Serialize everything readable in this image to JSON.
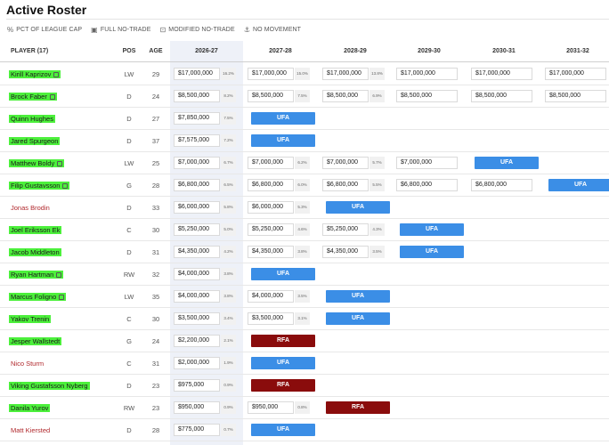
{
  "page": {
    "title": "Active Roster"
  },
  "legend": [
    {
      "icon": "%",
      "label": "PCT OF LEAGUE CAP",
      "name": "pct-legend"
    },
    {
      "icon": "▣",
      "label": "FULL NO-TRADE",
      "name": "full-no-trade-legend"
    },
    {
      "icon": "⊡",
      "label": "MODIFIED NO-TRADE",
      "name": "modified-no-trade-legend"
    },
    {
      "icon": "⚓",
      "label": "NO MOVEMENT",
      "name": "no-movement-legend"
    }
  ],
  "table": {
    "headers": {
      "player": "PLAYER (17)",
      "pos": "POS",
      "age": "AGE",
      "years": [
        "2026-27",
        "2027-28",
        "2028-29",
        "2029-30",
        "2030-31",
        "2031-32"
      ]
    },
    "rows": [
      {
        "player": "Kirill Kaprizov",
        "clause": true,
        "highlight": true,
        "pos": "LW",
        "age": "29",
        "cells": [
          {
            "v": "$17,000,000",
            "p": "16.2%"
          },
          {
            "v": "$17,000,000",
            "p": "15.0%"
          },
          {
            "v": "$17,000,000",
            "p": "13.8%"
          },
          {
            "v": "$17,000,000"
          },
          {
            "v": "$17,000,000"
          },
          {
            "v": "$17,000,000"
          }
        ]
      },
      {
        "player": "Brock Faber",
        "clause": true,
        "highlight": true,
        "pos": "D",
        "age": "24",
        "cells": [
          {
            "v": "$8,500,000",
            "p": "8.2%"
          },
          {
            "v": "$8,500,000",
            "p": "7.5%"
          },
          {
            "v": "$8,500,000",
            "p": "6.9%"
          },
          {
            "v": "$8,500,000"
          },
          {
            "v": "$8,500,000"
          },
          {
            "v": "$8,500,000"
          }
        ]
      },
      {
        "player": "Quinn Hughes",
        "clause": false,
        "highlight": true,
        "pos": "D",
        "age": "27",
        "cells": [
          {
            "v": "$7,850,000",
            "p": "7.5%"
          },
          {
            "badge": "UFA"
          }
        ]
      },
      {
        "player": "Jared Spurgeon",
        "clause": false,
        "highlight": true,
        "pos": "D",
        "age": "37",
        "cells": [
          {
            "v": "$7,575,000",
            "p": "7.2%"
          },
          {
            "badge": "UFA"
          }
        ]
      },
      {
        "player": "Matthew Boldy",
        "clause": true,
        "highlight": true,
        "pos": "LW",
        "age": "25",
        "cells": [
          {
            "v": "$7,000,000",
            "p": "6.7%"
          },
          {
            "v": "$7,000,000",
            "p": "6.2%"
          },
          {
            "v": "$7,000,000",
            "p": "5.7%"
          },
          {
            "v": "$7,000,000"
          },
          {
            "badge": "UFA"
          }
        ]
      },
      {
        "player": "Filip Gustavsson",
        "clause": true,
        "highlight": true,
        "pos": "G",
        "age": "28",
        "cells": [
          {
            "v": "$6,800,000",
            "p": "6.5%"
          },
          {
            "v": "$6,800,000",
            "p": "6.0%"
          },
          {
            "v": "$6,800,000",
            "p": "5.5%"
          },
          {
            "v": "$6,800,000"
          },
          {
            "v": "$6,800,000"
          },
          {
            "badge": "UFA"
          }
        ]
      },
      {
        "player": "Jonas Brodin",
        "clause": false,
        "highlight": false,
        "red": true,
        "pos": "D",
        "age": "33",
        "cells": [
          {
            "v": "$6,000,000",
            "p": "5.8%"
          },
          {
            "v": "$6,000,000",
            "p": "5.3%"
          },
          {
            "badge": "UFA"
          }
        ]
      },
      {
        "player": "Joel Eriksson Ek",
        "clause": false,
        "highlight": true,
        "pos": "C",
        "age": "30",
        "cells": [
          {
            "v": "$5,250,000",
            "p": "5.0%"
          },
          {
            "v": "$5,250,000",
            "p": "4.6%"
          },
          {
            "v": "$5,250,000",
            "p": "4.3%"
          },
          {
            "badge": "UFA"
          }
        ]
      },
      {
        "player": "Jacob Middleton",
        "clause": false,
        "highlight": true,
        "pos": "D",
        "age": "31",
        "cells": [
          {
            "v": "$4,350,000",
            "p": "4.2%"
          },
          {
            "v": "$4,350,000",
            "p": "3.8%"
          },
          {
            "v": "$4,350,000",
            "p": "3.5%"
          },
          {
            "badge": "UFA"
          }
        ]
      },
      {
        "player": "Ryan Hartman",
        "clause": true,
        "highlight": true,
        "pos": "RW",
        "age": "32",
        "cells": [
          {
            "v": "$4,000,000",
            "p": "3.8%"
          },
          {
            "badge": "UFA"
          }
        ]
      },
      {
        "player": "Marcus Foligno",
        "clause": true,
        "highlight": true,
        "pos": "LW",
        "age": "35",
        "cells": [
          {
            "v": "$4,000,000",
            "p": "3.8%"
          },
          {
            "v": "$4,000,000",
            "p": "3.5%"
          },
          {
            "badge": "UFA"
          }
        ]
      },
      {
        "player": "Yakov Trenin",
        "clause": false,
        "highlight": true,
        "pos": "C",
        "age": "30",
        "cells": [
          {
            "v": "$3,500,000",
            "p": "3.4%"
          },
          {
            "v": "$3,500,000",
            "p": "3.1%"
          },
          {
            "badge": "UFA"
          }
        ]
      },
      {
        "player": "Jesper Wallstedt",
        "clause": false,
        "highlight": true,
        "pos": "G",
        "age": "24",
        "cells": [
          {
            "v": "$2,200,000",
            "p": "2.1%"
          },
          {
            "badge": "RFA"
          }
        ]
      },
      {
        "player": "Nico Sturm",
        "clause": false,
        "highlight": false,
        "red": true,
        "pos": "C",
        "age": "31",
        "cells": [
          {
            "v": "$2,000,000",
            "p": "1.9%"
          },
          {
            "badge": "UFA"
          }
        ]
      },
      {
        "player": "Viking Gustafsson Nyberg",
        "clause": false,
        "highlight": true,
        "pos": "D",
        "age": "23",
        "cells": [
          {
            "v": "$975,000",
            "p": "0.9%"
          },
          {
            "badge": "RFA"
          }
        ]
      },
      {
        "player": "Danila Yurov",
        "clause": false,
        "highlight": true,
        "pos": "RW",
        "age": "23",
        "cells": [
          {
            "v": "$950,000",
            "p": "0.9%"
          },
          {
            "v": "$950,000",
            "p": "0.8%"
          },
          {
            "badge": "RFA"
          }
        ]
      },
      {
        "player": "Matt Kiersted",
        "clause": false,
        "highlight": false,
        "red": true,
        "pos": "D",
        "age": "28",
        "cells": [
          {
            "v": "$775,000",
            "p": "0.7%"
          },
          {
            "badge": "UFA"
          }
        ]
      }
    ]
  }
}
